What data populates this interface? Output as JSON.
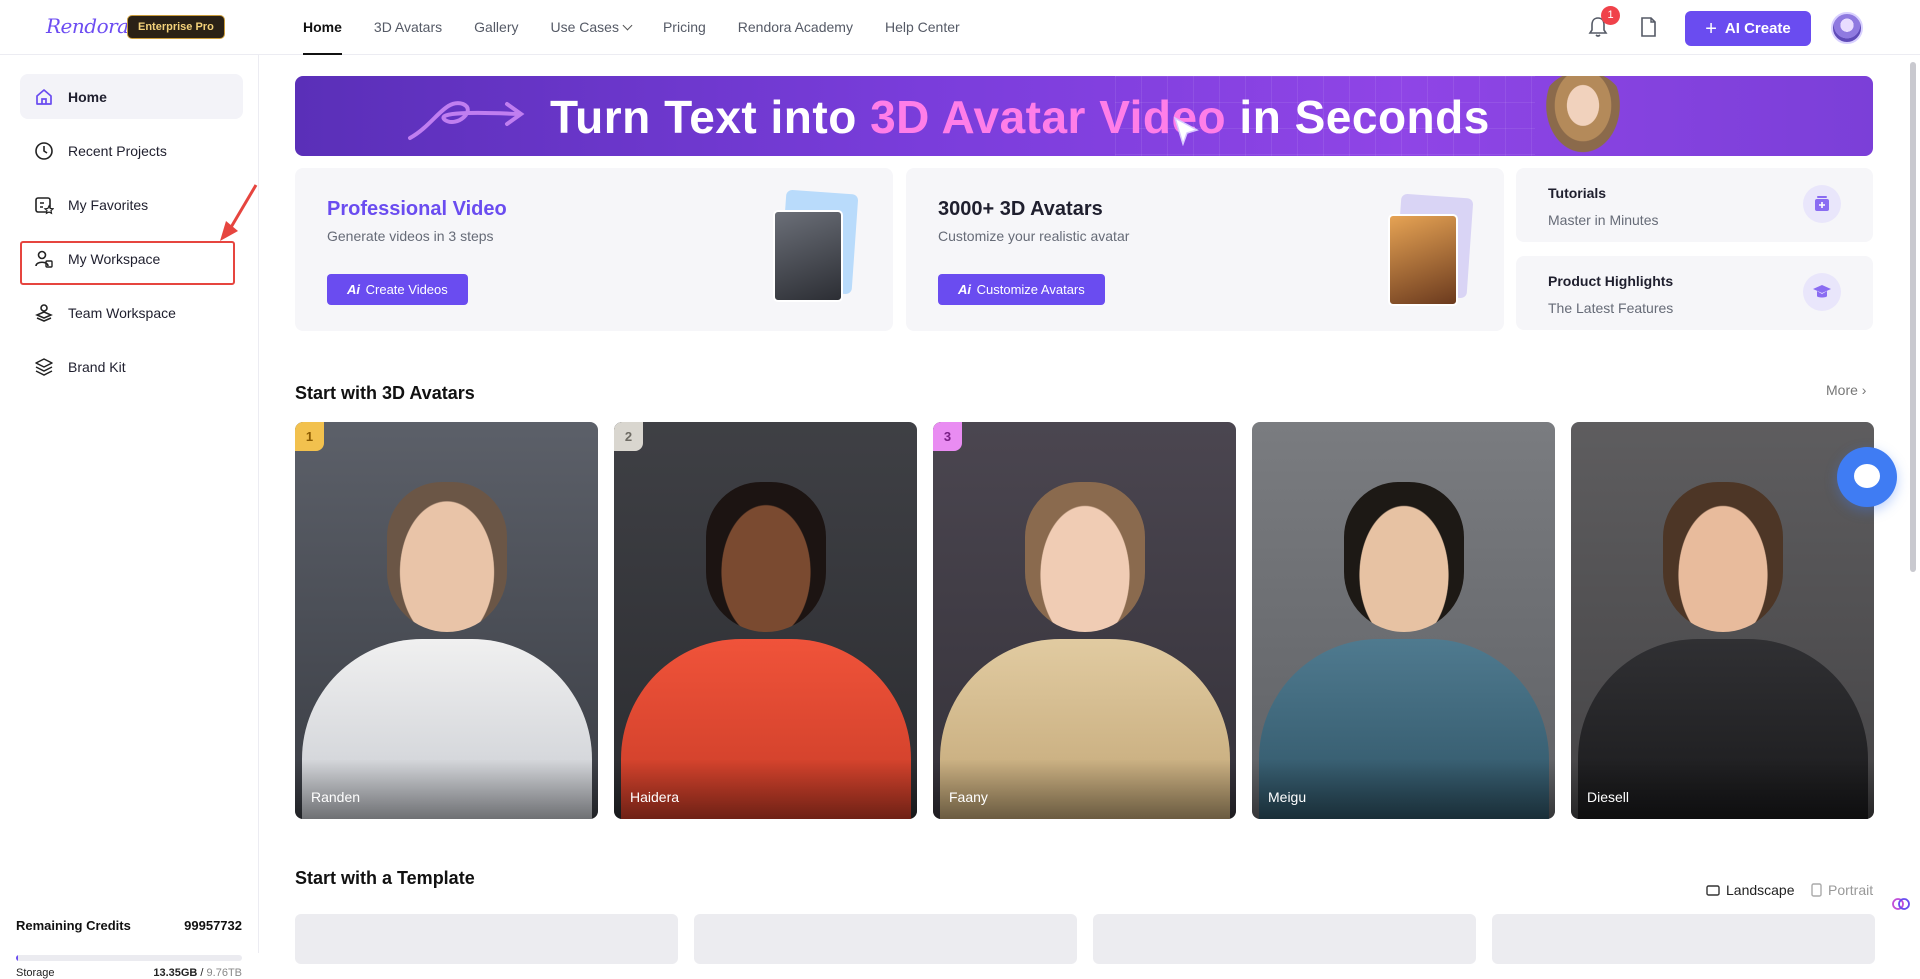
{
  "brand": {
    "logo": "Rendora",
    "plan_badge": "Enterprise Pro"
  },
  "nav": {
    "items": [
      {
        "label": "Home",
        "active": true
      },
      {
        "label": "3D Avatars"
      },
      {
        "label": "Gallery"
      },
      {
        "label": "Use Cases",
        "dropdown": true
      },
      {
        "label": "Pricing"
      },
      {
        "label": "Rendora Academy"
      },
      {
        "label": "Help Center"
      }
    ],
    "notification_count": "1",
    "ai_create_label": "AI Create"
  },
  "sidebar": {
    "items": [
      {
        "label": "Home",
        "icon": "home-icon",
        "active": true
      },
      {
        "label": "Recent Projects",
        "icon": "clock-icon"
      },
      {
        "label": "My Favorites",
        "icon": "favorites-icon"
      },
      {
        "label": "My Workspace",
        "icon": "workspace-icon",
        "highlighted": true
      },
      {
        "label": "Team Workspace",
        "icon": "team-icon"
      },
      {
        "label": "Brand Kit",
        "icon": "layers-icon"
      }
    ],
    "credits_label": "Remaining Credits",
    "credits_value": "99957732",
    "storage_label": "Storage",
    "storage_used": "13.35GB",
    "storage_sep": " / ",
    "storage_total": "9.76TB",
    "storage_fraction": 0.0013
  },
  "banner": {
    "text_before": "Turn Text into ",
    "text_accent": "3D Avatar Video",
    "text_after": " in Seconds"
  },
  "cards": {
    "professional": {
      "title": "Professional Video",
      "subtitle": "Generate videos in 3 steps",
      "button_prefix": "Ai",
      "button": "Create Videos"
    },
    "avatars": {
      "title": "3000+ 3D Avatars",
      "subtitle": "Customize your realistic avatar",
      "button_prefix": "Ai",
      "button": "Customize Avatars"
    },
    "tutorials": {
      "title": "Tutorials",
      "subtitle": "Master in Minutes"
    },
    "highlights": {
      "title": "Product Highlights",
      "subtitle": "The Latest Features"
    }
  },
  "avatars_section": {
    "title": "Start with 3D Avatars",
    "more": "More",
    "items": [
      {
        "name": "Randen",
        "rank": "1",
        "rank_color": "#f2c14e"
      },
      {
        "name": "Haidera",
        "rank": "2",
        "rank_color": "#d9d6cf"
      },
      {
        "name": "Faany",
        "rank": "3",
        "rank_color": "#e98cf2"
      },
      {
        "name": "Meigu",
        "rank": ""
      },
      {
        "name": "Diesell",
        "rank": ""
      }
    ]
  },
  "template_section": {
    "title": "Start with a Template",
    "landscape": "Landscape",
    "portrait": "Portrait"
  },
  "colors": {
    "accent": "#6a4cf0",
    "banner_accent": "#ff7ee8",
    "notification": "#f0424a",
    "annotation": "#e6453f"
  }
}
